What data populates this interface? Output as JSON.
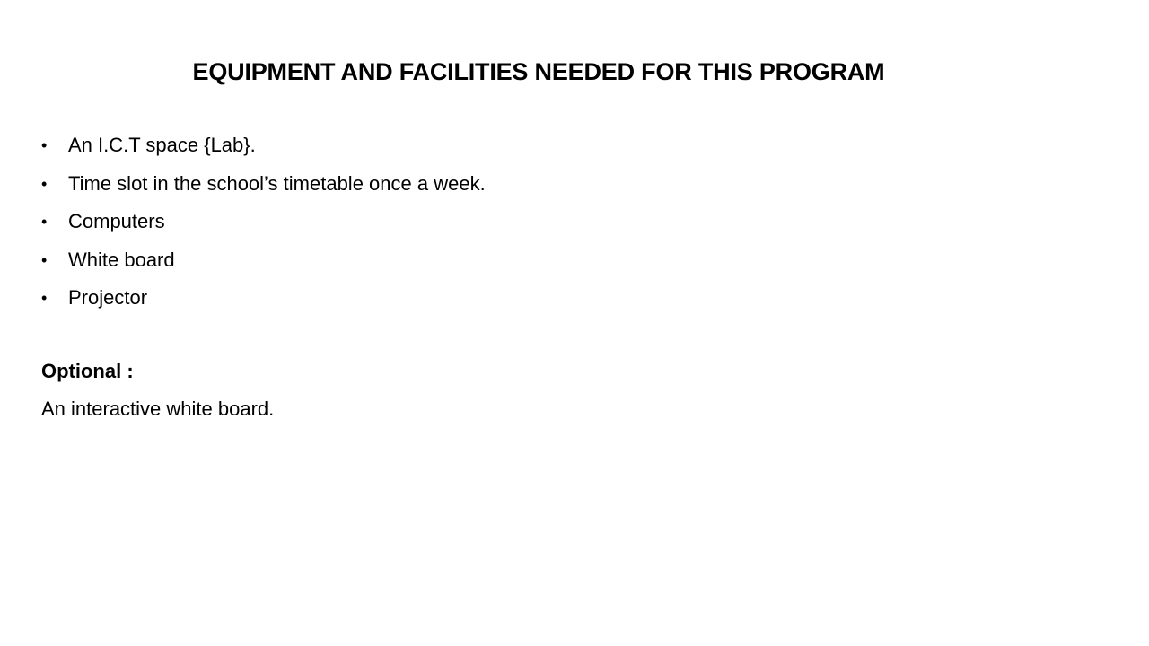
{
  "slide": {
    "title": "EQUIPMENT AND FACILITIES NEEDED FOR THIS PROGRAM",
    "bullet_symbol": "•",
    "items": [
      {
        "text": "An I.C.T space {Lab}."
      },
      {
        "text": "Time slot in the school’s timetable once a week."
      },
      {
        "text": "Computers"
      },
      {
        "text": "White board"
      },
      {
        "text": "Projector"
      }
    ],
    "optional": {
      "label": "Optional :",
      "text": "An interactive white board."
    }
  }
}
